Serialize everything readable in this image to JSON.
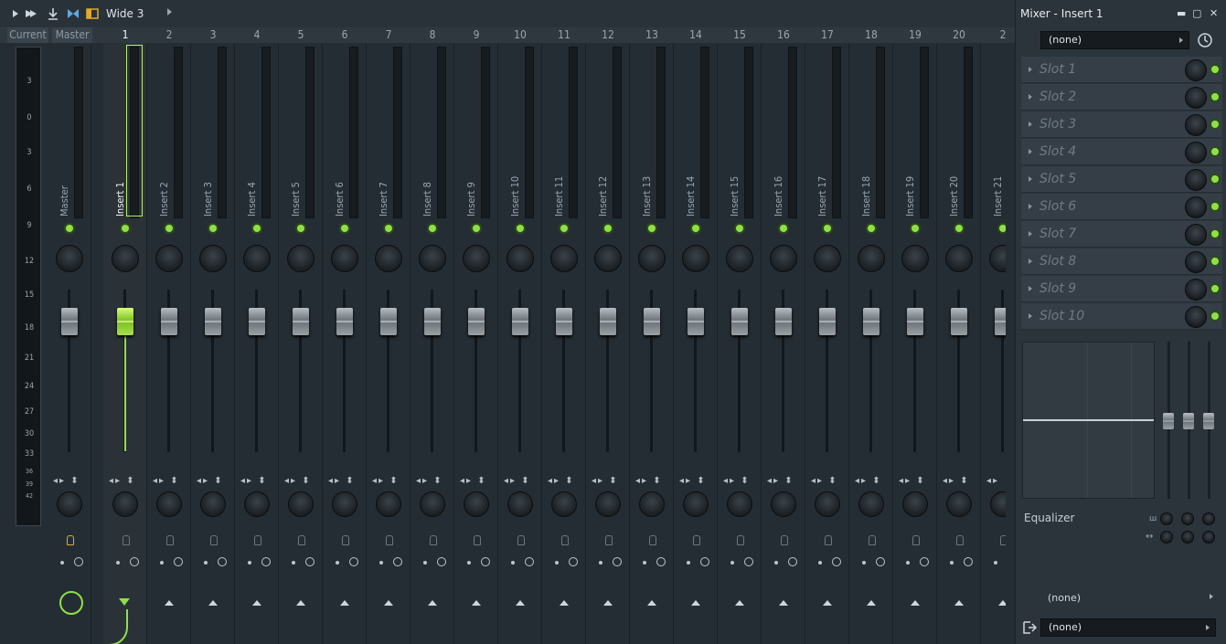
{
  "toolbar": {
    "preset": "Wide 3"
  },
  "header": {
    "current": "Current",
    "master": "Master",
    "numbers": [
      "1",
      "2",
      "3",
      "4",
      "5",
      "6",
      "7",
      "8",
      "9",
      "10",
      "11",
      "12",
      "13",
      "14",
      "15",
      "16",
      "17",
      "18",
      "19",
      "20",
      "2"
    ]
  },
  "meter_scale": [
    "3",
    "0",
    "3",
    "6",
    "9",
    "12",
    "15",
    "18",
    "21",
    "24",
    "27",
    "30",
    "33",
    "36",
    "39",
    "42"
  ],
  "strips": {
    "master_name": "Master",
    "insert_names": [
      "Insert 1",
      "Insert 2",
      "Insert 3",
      "Insert 4",
      "Insert 5",
      "Insert 6",
      "Insert 7",
      "Insert 8",
      "Insert 9",
      "Insert 10",
      "Insert 11",
      "Insert 12",
      "Insert 13",
      "Insert 14",
      "Insert 15",
      "Insert 16",
      "Insert 17",
      "Insert 18",
      "Insert 19",
      "Insert 20",
      "Insert 21"
    ],
    "selected": "Insert 1"
  },
  "panel": {
    "title": "Mixer - Insert 1",
    "preset_select": "(none)",
    "slots": [
      "Slot 1",
      "Slot 2",
      "Slot 3",
      "Slot 4",
      "Slot 5",
      "Slot 6",
      "Slot 7",
      "Slot 8",
      "Slot 9",
      "Slot 10"
    ],
    "eq_label": "Equalizer",
    "route_in": "(none)",
    "route_out": "(none)"
  },
  "colors": {
    "accent": "#8fe046",
    "record_arm": "#e3a92d",
    "background": "#252d34"
  }
}
